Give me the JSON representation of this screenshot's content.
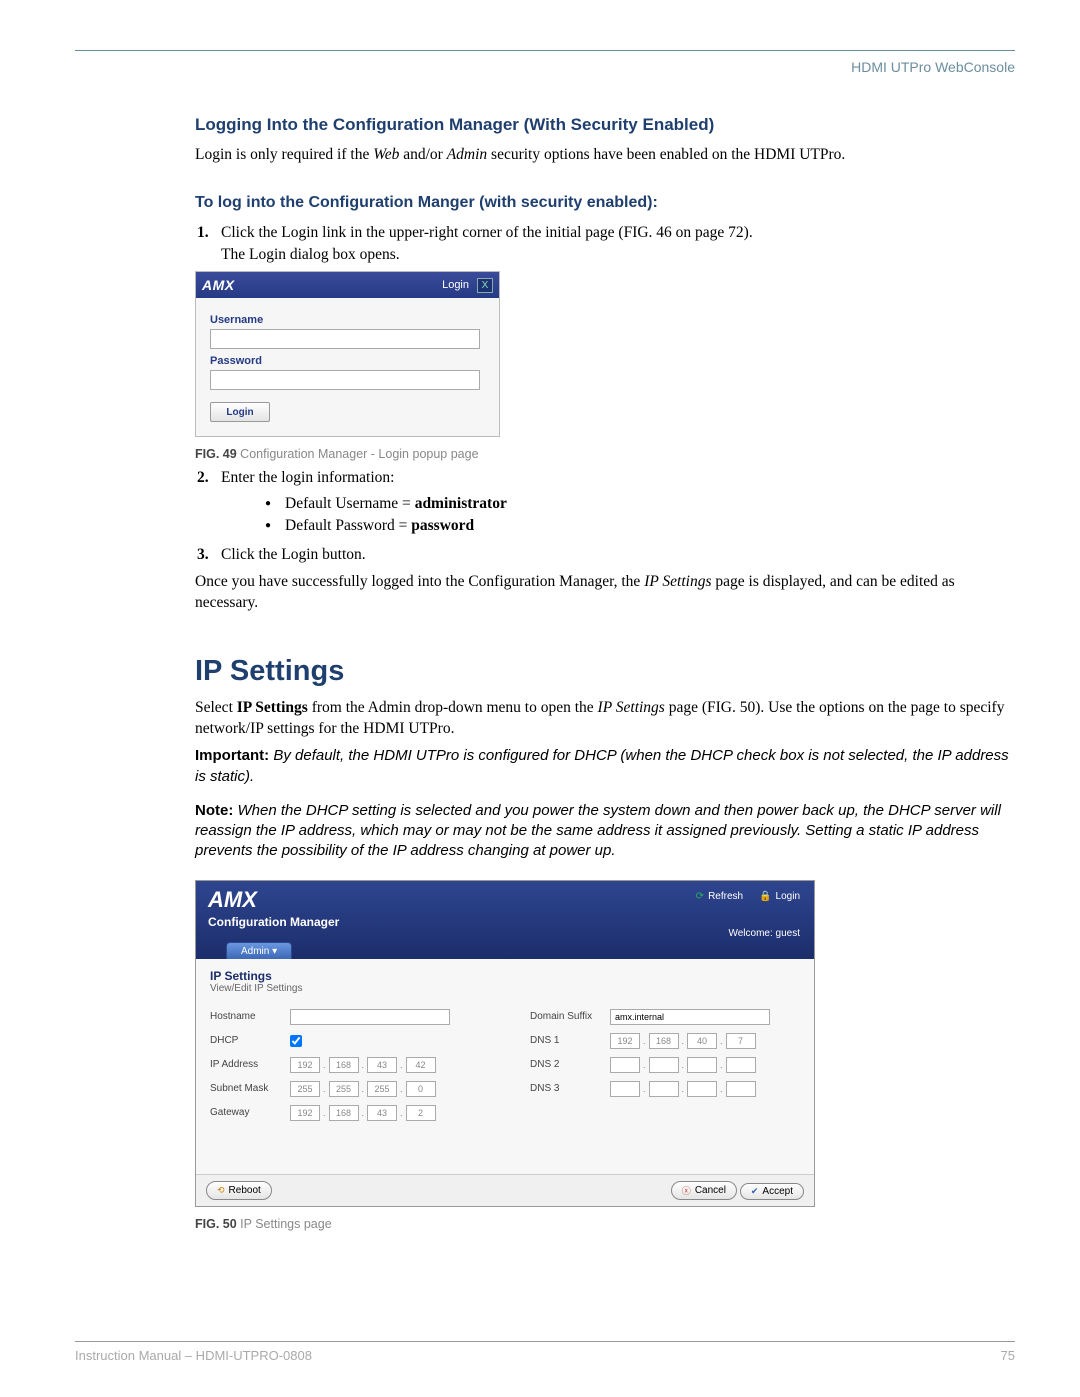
{
  "header": {
    "title": "HDMI UTPro WebConsole"
  },
  "section1": {
    "heading": "Logging Into the Configuration Manager (With Security Enabled)",
    "intro_pre": "Login is only required if the ",
    "intro_web": "Web",
    "intro_mid": " and/or ",
    "intro_admin": "Admin",
    "intro_post": " security options have been enabled on the HDMI UTPro."
  },
  "section2": {
    "heading": "To log into the Configuration Manger (with security enabled):"
  },
  "steps": {
    "s1_num": "1.",
    "s1a": "Click the Login link in the upper-right corner of the initial page (FIG. 46 on page 72).",
    "s1b": "The Login dialog box opens.",
    "s2_num": "2.",
    "s2": "Enter the login information:",
    "b1_pre": "Default Username = ",
    "b1_bold": "administrator",
    "b2_pre": "Default Password = ",
    "b2_bold": "password",
    "s3_num": "3.",
    "s3": "Click the Login button."
  },
  "login_fig": {
    "logo": "AMX",
    "login_link": "Login",
    "close": "X",
    "username_label": "Username",
    "password_label": "Password",
    "button": "Login"
  },
  "caption49": {
    "tag": "FIG. 49",
    "text": "  Configuration Manager - Login popup page"
  },
  "para_after_steps_pre": "Once you have successfully logged into the Configuration Manager, the ",
  "para_after_steps_em": "IP Settings",
  "para_after_steps_post": " page is displayed, and can be edited as necessary.",
  "ip_section": {
    "title": "IP Settings",
    "p1_pre": "Select ",
    "p1_bold": "IP Settings",
    "p1_mid": " from the Admin drop-down menu to open the ",
    "p1_em": "IP Settings",
    "p1_post": " page (FIG. 50). Use the options on the page to specify network/IP settings for the HDMI UTPro.",
    "important_label": "Important:",
    "important_text": " By default, the HDMI UTPro is configured for DHCP (when the DHCP check box is not selected, the IP address is static).",
    "note_label": "Note:",
    "note_text": " When the DHCP setting is selected and you power the system down and then power back up, the DHCP server will reassign the IP address, which may or may not be the same address it assigned previously. Setting a static IP address prevents the possibility of the IP address changing at power up."
  },
  "ip_fig": {
    "logo": "AMX",
    "cm": "Configuration Manager",
    "refresh": "Refresh",
    "login": "Login",
    "welcome": "Welcome: guest",
    "tab": "Admin ▾",
    "title": "IP Settings",
    "subtitle": "View/Edit IP Settings",
    "hostname_label": "Hostname",
    "dhcp_label": "DHCP",
    "ipaddr_label": "IP Address",
    "subnet_label": "Subnet Mask",
    "gateway_label": "Gateway",
    "suffix_label": "Domain Suffix",
    "dns1_label": "DNS 1",
    "dns2_label": "DNS 2",
    "dns3_label": "DNS 3",
    "ip": [
      "192",
      "168",
      "43",
      "42"
    ],
    "mask": [
      "255",
      "255",
      "255",
      "0"
    ],
    "gw": [
      "192",
      "168",
      "43",
      "2"
    ],
    "suffix_value": "amx.internal",
    "dns1": [
      "192",
      "168",
      "40",
      "7"
    ],
    "reboot": "Reboot",
    "cancel": "Cancel",
    "accept": "Accept"
  },
  "caption50": {
    "tag": "FIG. 50",
    "text": "  IP Settings page"
  },
  "footer": {
    "left": "Instruction Manual – HDMI-UTPRO-0808",
    "page": "75"
  }
}
